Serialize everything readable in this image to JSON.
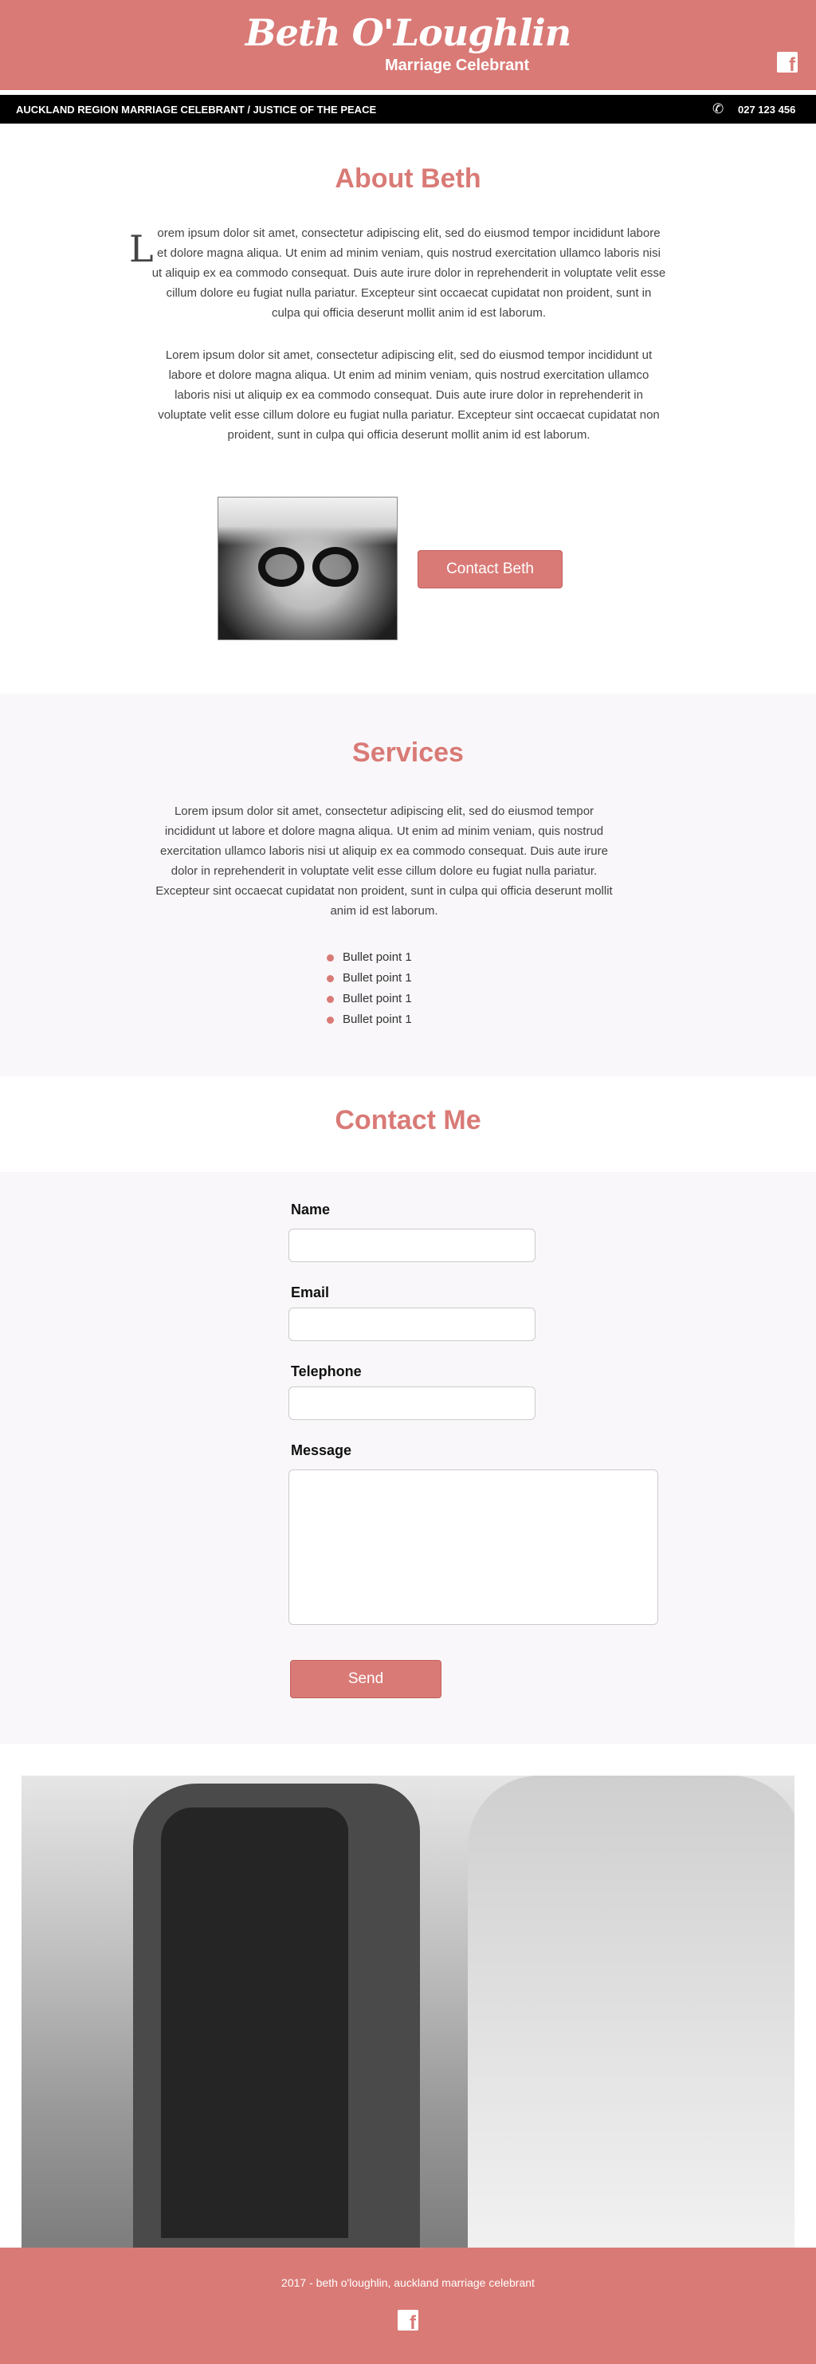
{
  "header": {
    "title": "Beth O'Loughlin",
    "subtitle": "Marriage Celebrant",
    "social_icon": "facebook-icon"
  },
  "topbar": {
    "tagline": "AUCKLAND REGION MARRIAGE CELEBRANT / JUSTICE OF THE PEACE",
    "phone_icon": "phone-icon",
    "phone": "027 123 456"
  },
  "about": {
    "title": "About Beth",
    "dropcap": "L",
    "para1": "orem ipsum dolor sit amet, consectetur adipiscing elit, sed do eiusmod tempor incididunt labore et dolore magna aliqua. Ut enim ad minim veniam, quis nostrud exercitation ullamco laboris nisi ut aliquip ex ea commodo consequat. Duis aute irure dolor in reprehenderit in voluptate velit esse cillum dolore eu fugiat nulla pariatur. Excepteur sint occaecat cupidatat non proident, sunt in culpa qui officia deserunt mollit anim id est laborum.",
    "para2": "Lorem ipsum dolor sit amet, consectetur adipiscing elit, sed do eiusmod tempor incididunt ut labore et dolore magna aliqua. Ut enim ad minim veniam, quis nostrud exercitation ullamco laboris nisi ut aliquip ex ea commodo consequat. Duis aute irure dolor in reprehenderit in voluptate velit esse cillum dolore eu fugiat nulla pariatur. Excepteur sint occaecat cupidatat non proident, sunt in culpa qui officia deserunt mollit anim id est laborum.",
    "button": "Contact Beth"
  },
  "services": {
    "title": "Services",
    "para": "Lorem ipsum dolor sit amet, consectetur adipiscing elit, sed do eiusmod tempor incididunt ut labore et dolore magna aliqua. Ut enim ad minim veniam, quis nostrud exercitation ullamco laboris nisi ut aliquip ex ea commodo consequat. Duis aute irure dolor in reprehenderit in voluptate velit esse cillum dolore eu fugiat nulla pariatur. Excepteur sint occaecat cupidatat non proident, sunt in culpa qui officia deserunt mollit anim id est laborum.",
    "bullets": [
      "Bullet point 1",
      "Bullet point 1",
      "Bullet point 1",
      "Bullet point 1"
    ]
  },
  "contact": {
    "title": "Contact Me",
    "name_label": "Name",
    "email_label": "Email",
    "telephone_label": "Telephone",
    "message_label": "Message",
    "name_value": "",
    "email_value": "",
    "telephone_value": "",
    "send_button": "Send"
  },
  "footer": {
    "text": "2017 - beth o'loughlin, auckland marriage celebrant",
    "social_icon": "facebook-icon"
  },
  "colors": {
    "accent": "#d97a76",
    "topbar": "#000000",
    "section_bg": "#f9f7f9"
  }
}
